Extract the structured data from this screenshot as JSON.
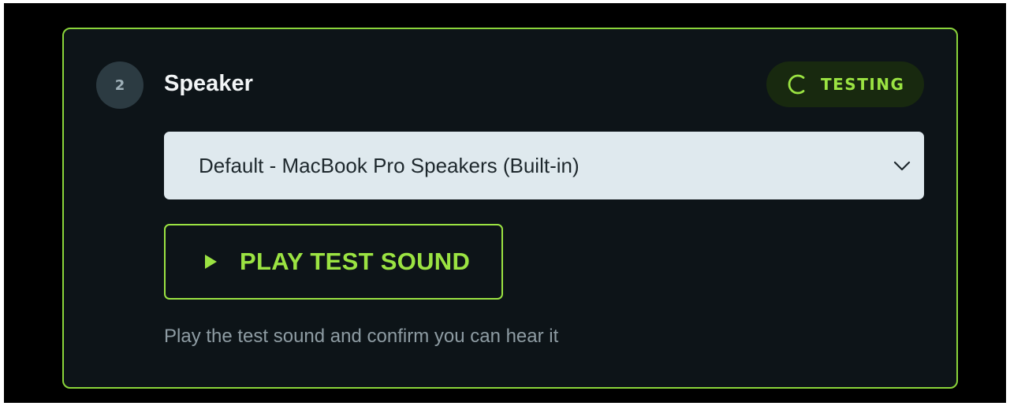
{
  "step": {
    "number": "2",
    "title": "Speaker"
  },
  "status": {
    "icon": "spinner-icon",
    "label": "TESTING",
    "color": "#9be342"
  },
  "speaker_select": {
    "selected": "Default - MacBook Pro Speakers (Built-in)",
    "icon": "chevron-down-icon"
  },
  "test_button": {
    "icon": "play-icon",
    "label": "PLAY TEST SOUND"
  },
  "hint": "Play the test sound and confirm you can hear it",
  "colors": {
    "accent": "#9be342",
    "card_background": "#0d1418",
    "select_background": "#dfe9ee"
  }
}
